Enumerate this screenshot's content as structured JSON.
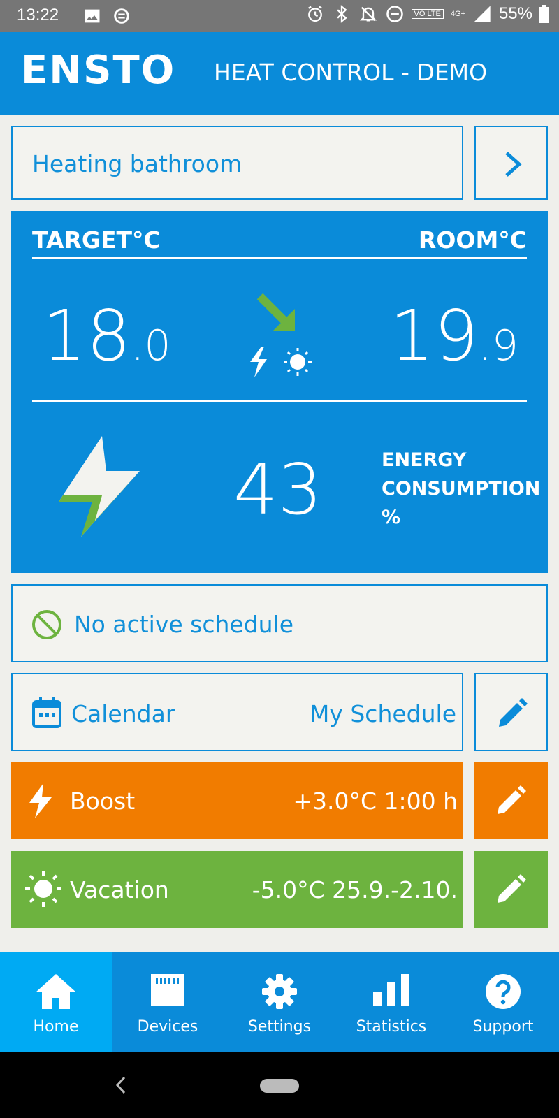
{
  "status_bar": {
    "time": "13:22",
    "network_badge": "VO LTE",
    "network_type": "4G+",
    "battery": "55%",
    "icons": [
      "image-icon",
      "sync-icon",
      "alarm-icon",
      "bluetooth-icon",
      "bell-off-icon",
      "do-not-disturb-icon",
      "signal-icon",
      "battery-icon"
    ]
  },
  "header": {
    "logo": "ENSTO",
    "title": "HEAT CONTROL - DEMO"
  },
  "room_selector": {
    "label": "Heating bathroom",
    "next_icon": "chevron-right-icon"
  },
  "panel": {
    "target_label": "TARGET°C",
    "room_label": "ROOM°C",
    "target_temp_int": "18",
    "target_temp_dec": ".0",
    "room_temp_int": "19",
    "room_temp_dec": ".9",
    "energy_value": "43",
    "energy_label_line1": "ENERGY",
    "energy_label_line2": "CONSUMPTION",
    "energy_label_line3": "%"
  },
  "schedule": {
    "status": "No active schedule",
    "calendar_label": "Calendar",
    "calendar_value": "My Schedule"
  },
  "boost": {
    "label": "Boost",
    "value": "+3.0°C 1:00 h"
  },
  "vacation": {
    "label": "Vacation",
    "value": "-5.0°C 25.9.-2.10."
  },
  "colors": {
    "primary": "#0a8bd9",
    "active_nav": "#00aaf3",
    "boost": "#f17c00",
    "vacation": "#6db33f",
    "background": "#efefeb"
  },
  "nav": [
    {
      "label": "Home",
      "icon": "home-icon",
      "active": true
    },
    {
      "label": "Devices",
      "icon": "devices-icon",
      "active": false
    },
    {
      "label": "Settings",
      "icon": "gear-icon",
      "active": false
    },
    {
      "label": "Statistics",
      "icon": "bar-chart-icon",
      "active": false
    },
    {
      "label": "Support",
      "icon": "help-icon",
      "active": false
    }
  ]
}
